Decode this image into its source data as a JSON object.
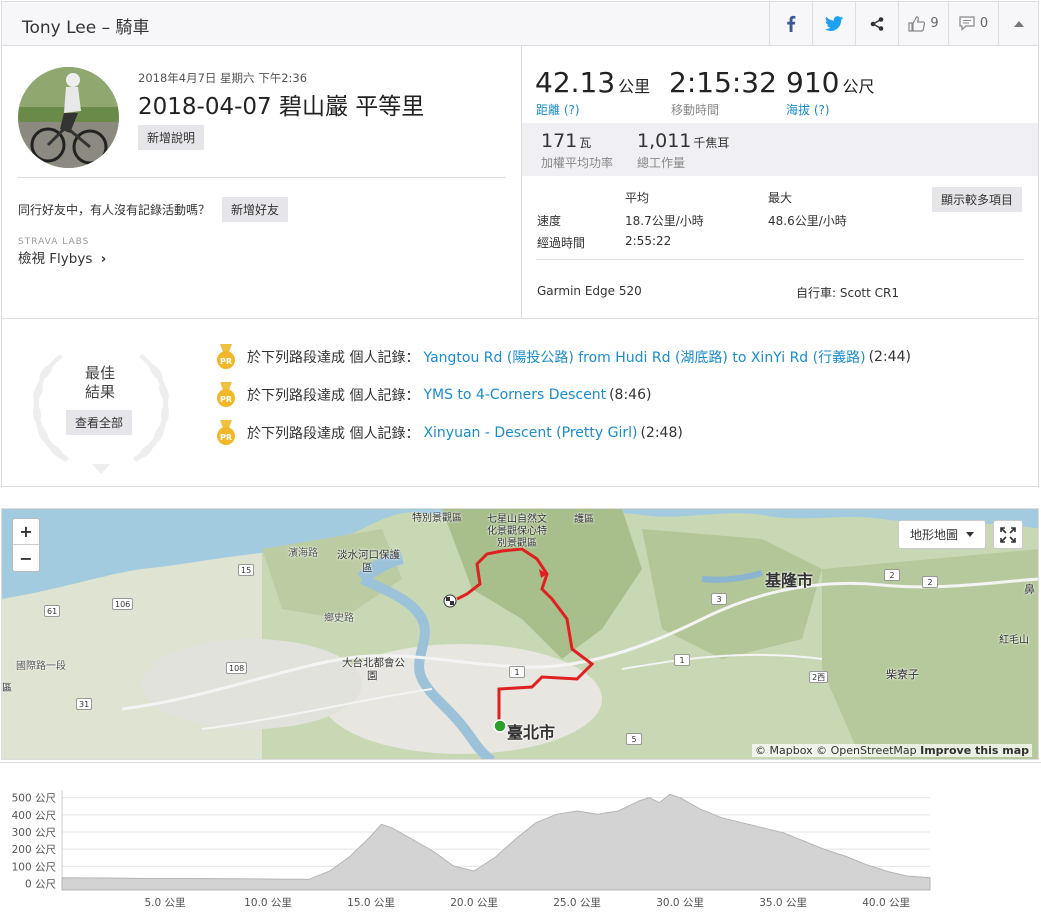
{
  "header": {
    "title": "Tony Lee – 騎車",
    "kudos_count": "9",
    "comment_count": "0"
  },
  "activity": {
    "datetime": "2018年4月7日 星期六 下午2:36",
    "title": "2018-04-07 碧山巖 平等里",
    "add_description": "新增說明",
    "friends_prompt": "同行好友中，有人沒有記錄活動嗎？",
    "add_friend": "新增好友",
    "labs_label": "STRAVA LABS",
    "flybys": "檢視 Flybys"
  },
  "stats": {
    "distance": "42.13",
    "distance_unit": "公里",
    "distance_label": "距離 (?)",
    "moving_time": "2:15:32",
    "moving_time_label": "移動時間",
    "elevation": "910",
    "elevation_unit": "公尺",
    "elevation_label": "海拔 (?)",
    "power": "171",
    "power_unit": "瓦",
    "power_label": "加權平均功率",
    "work": "1,011",
    "work_unit": "千焦耳",
    "work_label": "總工作量",
    "col_avg": "平均",
    "col_max": "最大",
    "show_more": "顯示較多項目",
    "speed_label": "速度",
    "speed_avg": "18.7公里/小時",
    "speed_max": "48.6公里/小時",
    "elapsed_label": "經過時間",
    "elapsed_avg": "2:55:22",
    "device": "Garmin Edge 520",
    "bike": "自行車: Scott CR1"
  },
  "best": {
    "title_line1": "最佳",
    "title_line2": "結果",
    "view_all": "查看全部",
    "medal_text": "PR",
    "achievements": [
      {
        "prefix": "於下列路段達成 個人記錄：",
        "segment": "Yangtou Rd (陽投公路) from Hudi Rd (湖底路) to XinYi Rd (行義路)",
        "time": "(2:44)"
      },
      {
        "prefix": "於下列路段達成 個人記錄：",
        "segment": "YMS to 4-Corners Descent",
        "time": "(8:46)"
      },
      {
        "prefix": "於下列路段達成 個人記錄：",
        "segment": "Xinyuan - Descent (Pretty Girl)",
        "time": "(2:48)"
      }
    ]
  },
  "map": {
    "zoom_in": "+",
    "zoom_out": "−",
    "map_type": "地形地圖",
    "attribution_1": "© Mapbox",
    "attribution_2": "© OpenStreetMap",
    "attribution_3": "Improve this map",
    "labels": {
      "keelung": "基隆市",
      "taipei": "臺北市",
      "taipei_park": "大台北都會公",
      "park2": "園",
      "tamsui_river": "淡水河口保護",
      "tamsui2": "區",
      "yms": "七星山自然文",
      "yms2": "化景觀保心特",
      "yms3": "別景觀區",
      "special": "特別景觀區",
      "protect": "護區",
      "hongmao": "紅毛山",
      "chailiao": "柴寮子",
      "intl_rd": "國際路一段",
      "binhai": "濱海路",
      "shezi": "鄉史路",
      "ding": "區",
      "bi": "鼻"
    },
    "shields": [
      "15",
      "106",
      "61",
      "108",
      "31",
      "1",
      "3",
      "1",
      "5",
      "2",
      "2",
      "2西"
    ],
    "colors": {
      "route": "#e02020",
      "start": "#2aa02a"
    }
  },
  "elevation_chart": {
    "y_ticks": [
      "500 公尺",
      "400 公尺",
      "300 公尺",
      "200 公尺",
      "100 公尺",
      "0 公尺"
    ],
    "x_ticks": [
      "5.0 公里",
      "10.0 公里",
      "15.0 公里",
      "20.0 公里",
      "25.0 公里",
      "30.0 公里",
      "35.0 公里",
      "40.0 公里"
    ]
  },
  "chart_data": {
    "type": "area",
    "title": "",
    "xlabel": "",
    "ylabel": "",
    "xlim": [
      0,
      42.13
    ],
    "ylim": [
      0,
      520
    ],
    "x": [
      0,
      2,
      4,
      6,
      8,
      10,
      11,
      12,
      13,
      14,
      15,
      15.5,
      16,
      17,
      18,
      19,
      20,
      21,
      22,
      23,
      24,
      25,
      26,
      27,
      28,
      28.5,
      29,
      29.5,
      30,
      31,
      32,
      33,
      34,
      35,
      36,
      37,
      38,
      39,
      40,
      41,
      42.13
    ],
    "y": [
      20,
      18,
      15,
      15,
      14,
      12,
      10,
      10,
      60,
      150,
      270,
      340,
      320,
      250,
      180,
      90,
      60,
      140,
      250,
      350,
      400,
      420,
      400,
      420,
      480,
      500,
      470,
      520,
      500,
      430,
      380,
      350,
      320,
      290,
      240,
      190,
      150,
      100,
      60,
      30,
      20
    ]
  }
}
